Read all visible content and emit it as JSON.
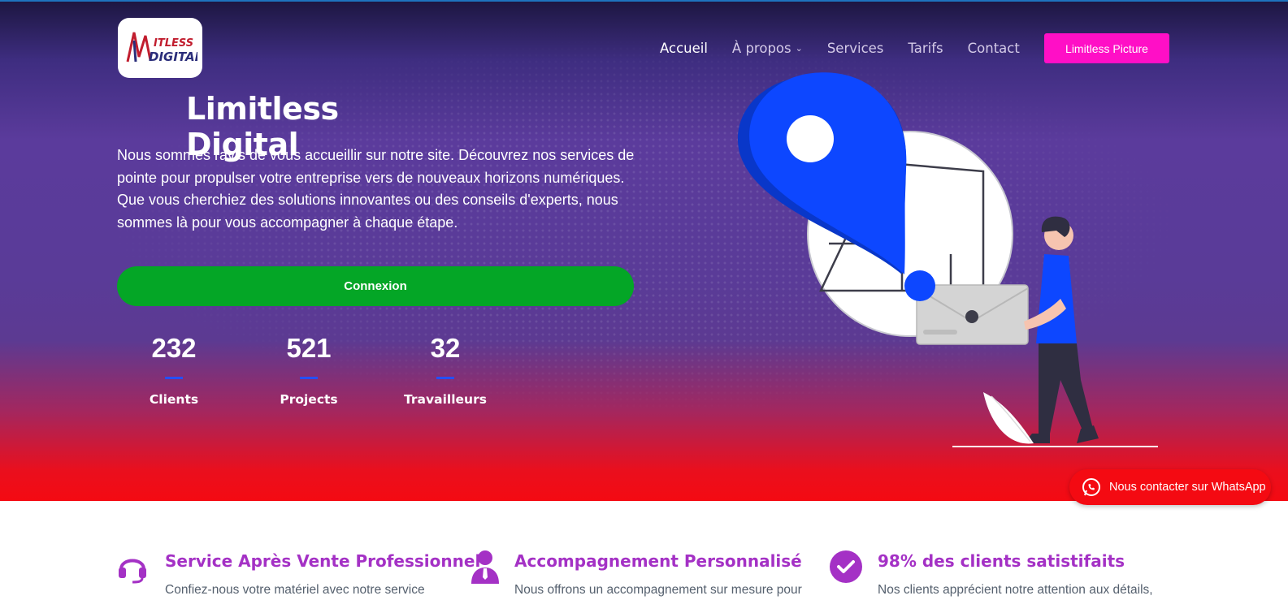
{
  "header": {
    "logo_text_line1": "ITLESS",
    "logo_text_line2": "DIGITAL",
    "nav": [
      {
        "label": "Accueil",
        "active": true
      },
      {
        "label": "À propos",
        "has_dropdown": true
      },
      {
        "label": "Services"
      },
      {
        "label": "Tarifs"
      },
      {
        "label": "Contact"
      }
    ],
    "cta_label": "Limitless Picture"
  },
  "hero": {
    "title": "Limitless Digital",
    "description": "Nous sommes ravis de vous accueillir sur notre site. Découvrez nos services de pointe pour propulser votre entreprise vers de nouveaux horizons numériques. Que vous cherchiez des solutions innovantes ou des conseils d'experts, nous sommes là pour vous accompagner à chaque étape.",
    "button_label": "Connexion",
    "stats": [
      {
        "value": "232",
        "label": "Clients"
      },
      {
        "value": "521",
        "label": "Projects"
      },
      {
        "value": "32",
        "label": "Travailleurs"
      }
    ]
  },
  "whatsapp": {
    "label": "Nous contacter sur WhatsApp"
  },
  "features": [
    {
      "icon": "headset-icon",
      "title": "Service Après Vente Professionnel",
      "desc": "Confiez-nous votre matériel avec notre service après-"
    },
    {
      "icon": "user-tie-icon",
      "title": "Accompagnement Personnalisé",
      "desc": "Nous offrons un accompagnement sur mesure pour"
    },
    {
      "icon": "check-circle-icon",
      "title": "98% des clients satistifaits",
      "desc": "Nos clients apprécient notre attention aux détails,"
    }
  ],
  "colors": {
    "accent": "#a431c5",
    "cta": "#ff0fc6",
    "connexion": "#04a626",
    "whatsapp": "#f40a12",
    "illustration_blue": "#0d47ff"
  }
}
